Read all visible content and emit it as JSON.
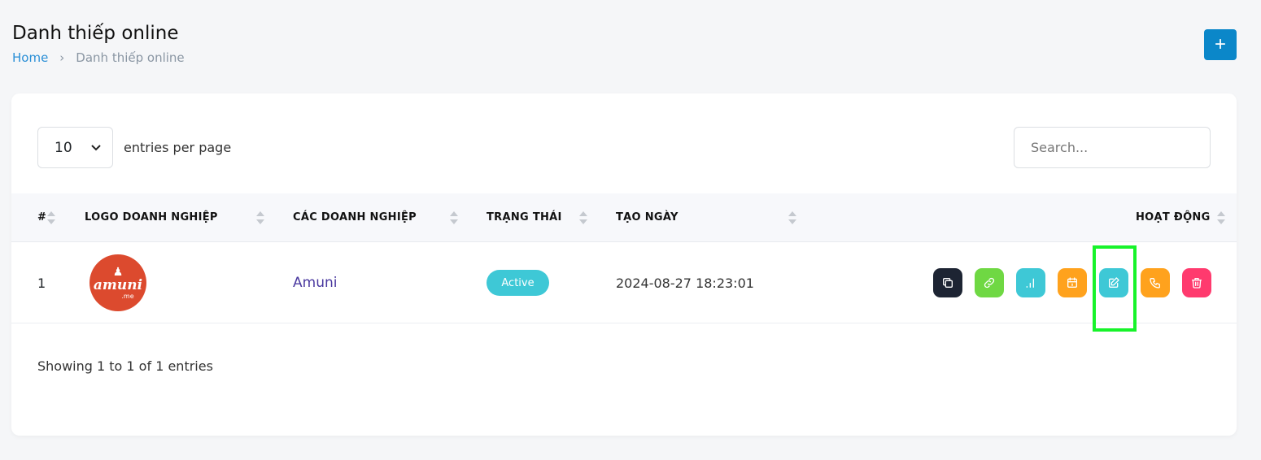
{
  "header": {
    "title": "Danh thiếp online",
    "breadcrumb": [
      "Home",
      "Danh thiếp online"
    ],
    "add_label": "+"
  },
  "controls": {
    "page_size": "10",
    "entries_per_page": "entries per page",
    "search_placeholder": "Search..."
  },
  "table": {
    "columns": [
      "#",
      "LOGO DOANH NGHIỆP",
      "CÁC DOANH NGHIỆP",
      "TRẠNG THÁI",
      "TẠO NGÀY",
      "HOẠT ĐỘNG"
    ],
    "rows": [
      {
        "index": "1",
        "logo_text": "amuni",
        "logo_sub": ".me",
        "company": "Amuni",
        "status": "Active",
        "created": "2024-08-27 18:23:01"
      }
    ]
  },
  "actions": [
    {
      "icon": "copy-icon",
      "color": "#1d2433"
    },
    {
      "icon": "link-icon",
      "color": "#6fd843"
    },
    {
      "icon": "chart-icon",
      "color": "#3ec8d6"
    },
    {
      "icon": "calendar-icon",
      "color": "#ffa21d"
    },
    {
      "icon": "edit-icon",
      "color": "#3ec8d6"
    },
    {
      "icon": "phone-icon",
      "color": "#ffa21d"
    },
    {
      "icon": "trash-icon",
      "color": "#ff3a6e"
    }
  ],
  "footer": {
    "info": "Showing 1 to 1 of 1 entries"
  },
  "colors": {
    "primary": "#0b87c9",
    "status_active": "#3ec8d6",
    "company_link": "#4b3aa0",
    "highlight": "#17f32a"
  }
}
